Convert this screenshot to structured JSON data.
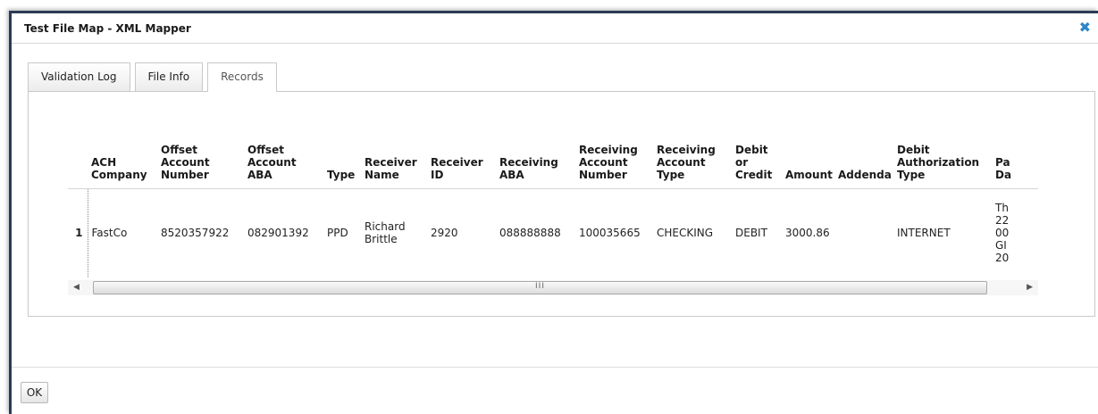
{
  "dialog": {
    "title": "Test File Map - XML Mapper",
    "close_glyph": "✖"
  },
  "tabs": [
    {
      "label": "Validation Log",
      "active": false
    },
    {
      "label": "File Info",
      "active": false
    },
    {
      "label": "Records",
      "active": true
    }
  ],
  "grid": {
    "columns": [
      {
        "label": "ACH\nCompany"
      },
      {
        "label": "Offset\nAccount\nNumber"
      },
      {
        "label": "Offset\nAccount\nABA"
      },
      {
        "label": "Type"
      },
      {
        "label": "Receiver\nName"
      },
      {
        "label": "Receiver\nID"
      },
      {
        "label": "Receiving\nABA"
      },
      {
        "label": "Receiving\nAccount\nNumber"
      },
      {
        "label": "Receiving\nAccount\nType"
      },
      {
        "label": "Debit\nor\nCredit"
      },
      {
        "label": "Amount"
      },
      {
        "label": "Addenda"
      },
      {
        "label": "Debit\nAuthorization\nType"
      },
      {
        "label": "Pa\nDa"
      }
    ],
    "rows": [
      {
        "row_number": "1",
        "cells": [
          "FastCo",
          "8520357922",
          "082901392",
          "PPD",
          "Richard\nBrittle",
          "2920",
          "088888888",
          "100035665",
          "CHECKING",
          "DEBIT",
          "3000.86",
          "",
          "INTERNET",
          "Th\n22\n00\nGI\n20"
        ]
      }
    ]
  },
  "scrollbar": {
    "left_arrow": "◀",
    "right_arrow": "▶",
    "grip": "III"
  },
  "footer": {
    "ok_label": "OK"
  }
}
